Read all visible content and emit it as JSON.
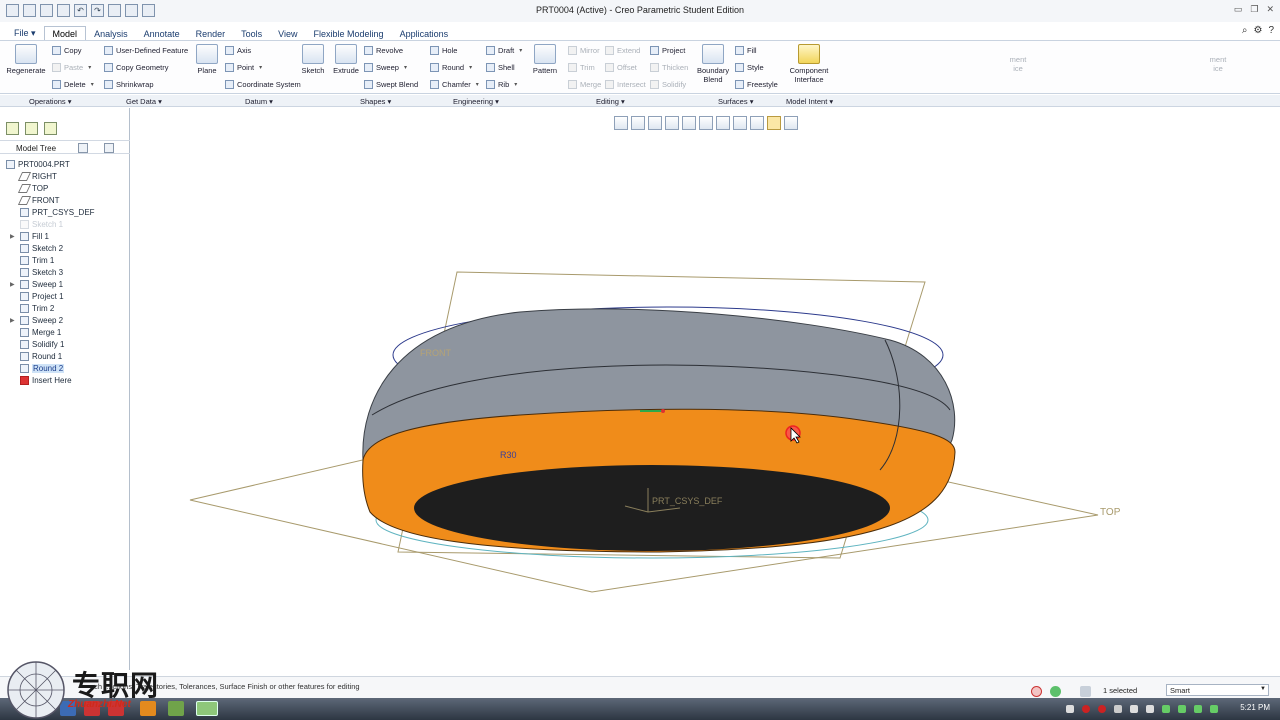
{
  "window": {
    "title": "PRT0004 (Active) - Creo Parametric Student Edition"
  },
  "menu": {
    "file": "File",
    "tabs": [
      "Model",
      "Analysis",
      "Annotate",
      "Render",
      "Tools",
      "View",
      "Flexible Modeling",
      "Applications"
    ],
    "active_tab": "Model"
  },
  "ribbon": {
    "regenerate": "Regenerate",
    "copy": "Copy",
    "paste": "Paste",
    "delete": "Delete",
    "user_defined_feature": "User-Defined Feature",
    "copy_geometry": "Copy Geometry",
    "shrinkwrap": "Shrinkwrap",
    "plane": "Plane",
    "axis": "Axis",
    "point": "Point",
    "coordinate_system": "Coordinate System",
    "sketch": "Sketch",
    "extrude": "Extrude",
    "revolve": "Revolve",
    "sweep": "Sweep",
    "swept_blend": "Swept Blend",
    "hole": "Hole",
    "round": "Round",
    "chamfer": "Chamfer",
    "draft": "Draft",
    "shell": "Shell",
    "rib": "Rib",
    "pattern": "Pattern",
    "mirror": "Mirror",
    "trim": "Trim",
    "merge": "Merge",
    "extend": "Extend",
    "offset": "Offset",
    "intersect": "Intersect",
    "project": "Project",
    "thicken": "Thicken",
    "solidify": "Solidify",
    "boundary_blend_1": "Boundary",
    "boundary_blend_2": "Blend",
    "fill": "Fill",
    "style": "Style",
    "freestyle": "Freestyle",
    "component_interface_1": "Component",
    "component_interface_2": "Interface",
    "trunc_1a": "ment",
    "trunc_1b": "ice",
    "trunc_2a": "ment",
    "trunc_2b": "ice"
  },
  "groups": [
    "Operations",
    "Get Data",
    "Datum",
    "Shapes",
    "Engineering",
    "Editing",
    "Surfaces",
    "Model Intent"
  ],
  "model_tree": {
    "title": "Model Tree",
    "items": [
      {
        "label": "PRT0004.PRT"
      },
      {
        "label": "RIGHT"
      },
      {
        "label": "TOP"
      },
      {
        "label": "FRONT"
      },
      {
        "label": "PRT_CSYS_DEF"
      },
      {
        "label": "Sketch 1"
      },
      {
        "label": "Fill 1"
      },
      {
        "label": "Sketch 2"
      },
      {
        "label": "Trim 1"
      },
      {
        "label": "Sketch 3"
      },
      {
        "label": "Sweep 1"
      },
      {
        "label": "Project 1"
      },
      {
        "label": "Trim 2"
      },
      {
        "label": "Sweep 2"
      },
      {
        "label": "Merge 1"
      },
      {
        "label": "Solidify 1"
      },
      {
        "label": "Round 1"
      },
      {
        "label": "Round 2"
      },
      {
        "label": "Insert Here"
      }
    ]
  },
  "graphics": {
    "plane_top_label": "TOP",
    "plane_front_label": "FRONT",
    "csys_label": "PRT_CSYS_DEF",
    "round_label": "R30",
    "colors": {
      "body": "#8e959f",
      "highlight": "#f08c1a",
      "inner": "#1e1e1e"
    }
  },
  "status": {
    "message_visible": "uch ... ctions, Trajectories, Tolerances, Surface Finish or other features for editing",
    "selected": "1 selected",
    "filter": "Smart"
  },
  "taskbar": {
    "clock": "5:21 PM"
  },
  "watermark": {
    "cn": "专职网",
    "en": "Zhuanzhi.Net"
  }
}
